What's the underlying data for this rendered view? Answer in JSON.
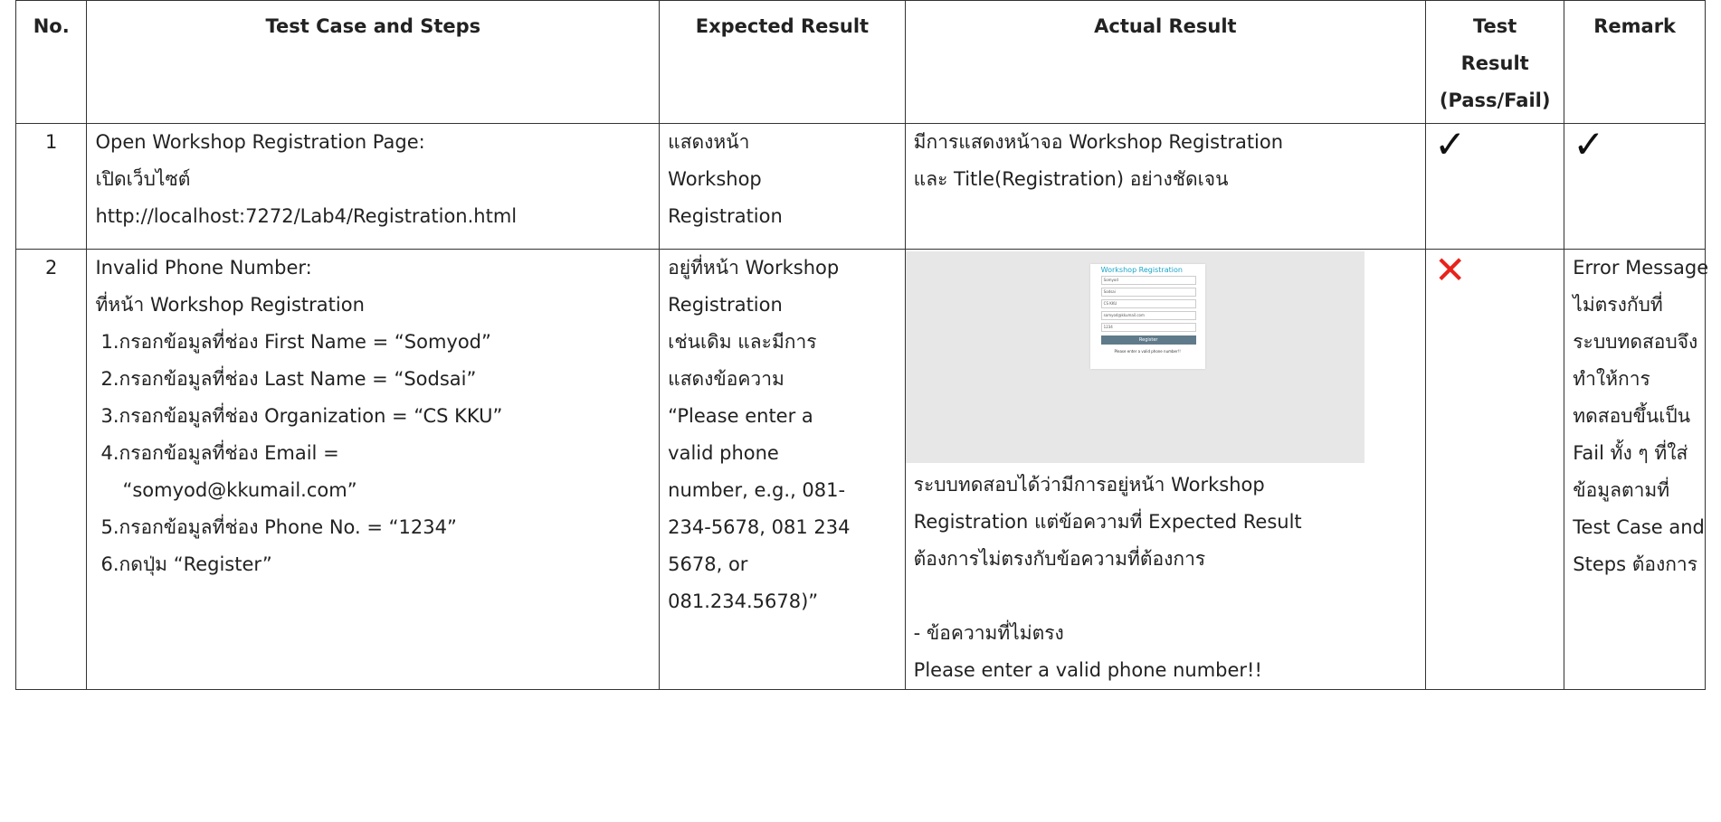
{
  "headers": {
    "no": "No.",
    "steps": "Test Case and Steps",
    "expected": "Expected Result",
    "actual": "Actual Result",
    "test_result_1": "Test",
    "test_result_2": "Result",
    "test_result_3": "(Pass/Fail)",
    "remark": "Remark"
  },
  "rows": [
    {
      "no": "1",
      "steps": [
        "Open Workshop Registration Page:",
        "เปิดเว็บไซต์",
        "http://localhost:7272/Lab4/Registration.html"
      ],
      "expected": [
        "แสดงหน้า",
        "Workshop",
        "Registration"
      ],
      "actual": [
        "มีการแสดงหน้าจอ Workshop Registration",
        "และ Title(Registration) อย่างชัดเจน"
      ],
      "test_result_icon": "check-mark",
      "test_result_symbol": "✓",
      "remark_icon": "check-mark",
      "remark_symbol": "✓"
    },
    {
      "no": "2",
      "steps": [
        "Invalid Phone Number:",
        "ที่หน้า Workshop Registration",
        "1.กรอกข้อมูลที่ช่อง First Name = “Somyod”",
        "2.กรอกข้อมูลที่ช่อง Last Name = “Sodsai”",
        "3.กรอกข้อมูลที่ช่อง Organization = “CS KKU”",
        "4.กรอกข้อมูลที่ช่อง Email =",
        "“somyod@kkumail.com”",
        "5.กรอกข้อมูลที่ช่อง Phone No. = “1234”",
        "6.กดปุ่ม “Register”"
      ],
      "expected": [
        "อยู่ที่หน้า Workshop",
        "Registration",
        "เช่นเดิม และมีการ",
        "แสดงข้อความ",
        "“Please enter a",
        "valid phone",
        "number, e.g., 081-",
        "234-5678, 081 234",
        "5678, or",
        "081.234.5678)”"
      ],
      "screenshot": {
        "title": "Workshop Registration",
        "fields": [
          "Somyod",
          "Sodsai",
          "CS KKU",
          "somyod@kkumail.com",
          "1234"
        ],
        "button": "Register",
        "message": "Please enter a valid phone number!!"
      },
      "actual": [
        "ระบบทดสอบได้ว่ามีการอยู่หน้า Workshop",
        "Registration แต่ข้อความที่ Expected Result",
        "ต้องการไม่ตรงกับข้อความที่ต้องการ",
        "",
        "- ข้อความที่ไม่ตรง",
        "Please enter a valid phone number!!"
      ],
      "test_result_icon": "cross-mark",
      "test_result_symbol": "✕",
      "remark": [
        "Error Message",
        "ไม่ตรงกับที่",
        "ระบบทดสอบจึง",
        "ทำให้การ",
        "ทดสอบขึ้นเป็น",
        "Fail ทั้ง ๆ ที่ใส่",
        "ข้อมูลตามที่",
        "Test Case and",
        "Steps ต้องการ"
      ]
    }
  ]
}
